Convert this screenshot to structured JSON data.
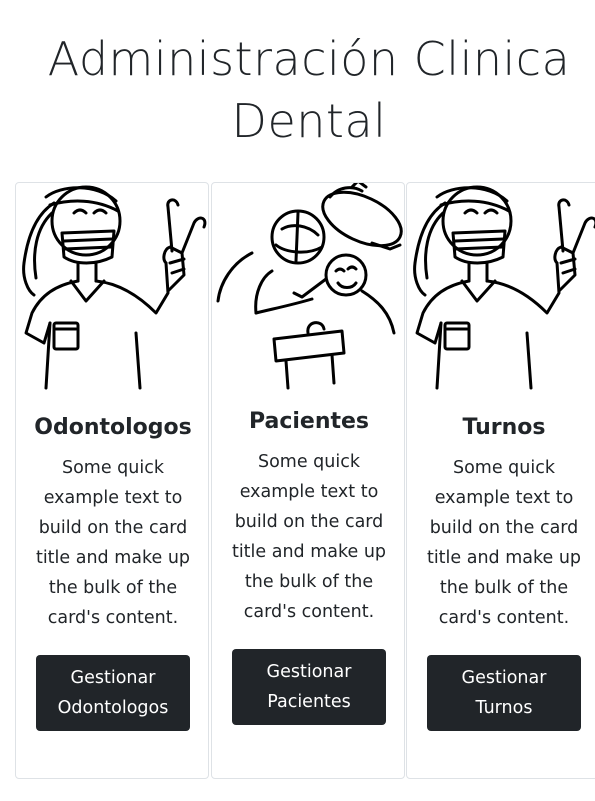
{
  "page": {
    "title": "Administración Clinica Dental"
  },
  "cards": [
    {
      "title": "Odontologos",
      "text": "Some quick example text to build on the card title and make up the bulk of the card's content.",
      "button_label": "Gestionar Odontologos",
      "image_icon": "dentist-illustration"
    },
    {
      "title": "Pacientes",
      "text": "Some quick example text to build on the card title and make up the bulk of the card's content.",
      "button_label": "Gestionar Pacientes",
      "image_icon": "patient-chair-illustration"
    },
    {
      "title": "Turnos",
      "text": "Some quick example text to build on the card title and make up the bulk of the card's content.",
      "button_label": "Gestionar Turnos",
      "image_icon": "dentist-illustration"
    }
  ],
  "colors": {
    "button_bg": "#212529",
    "button_text": "#ffffff",
    "card_border": "#dee2e6",
    "text": "#212529"
  }
}
